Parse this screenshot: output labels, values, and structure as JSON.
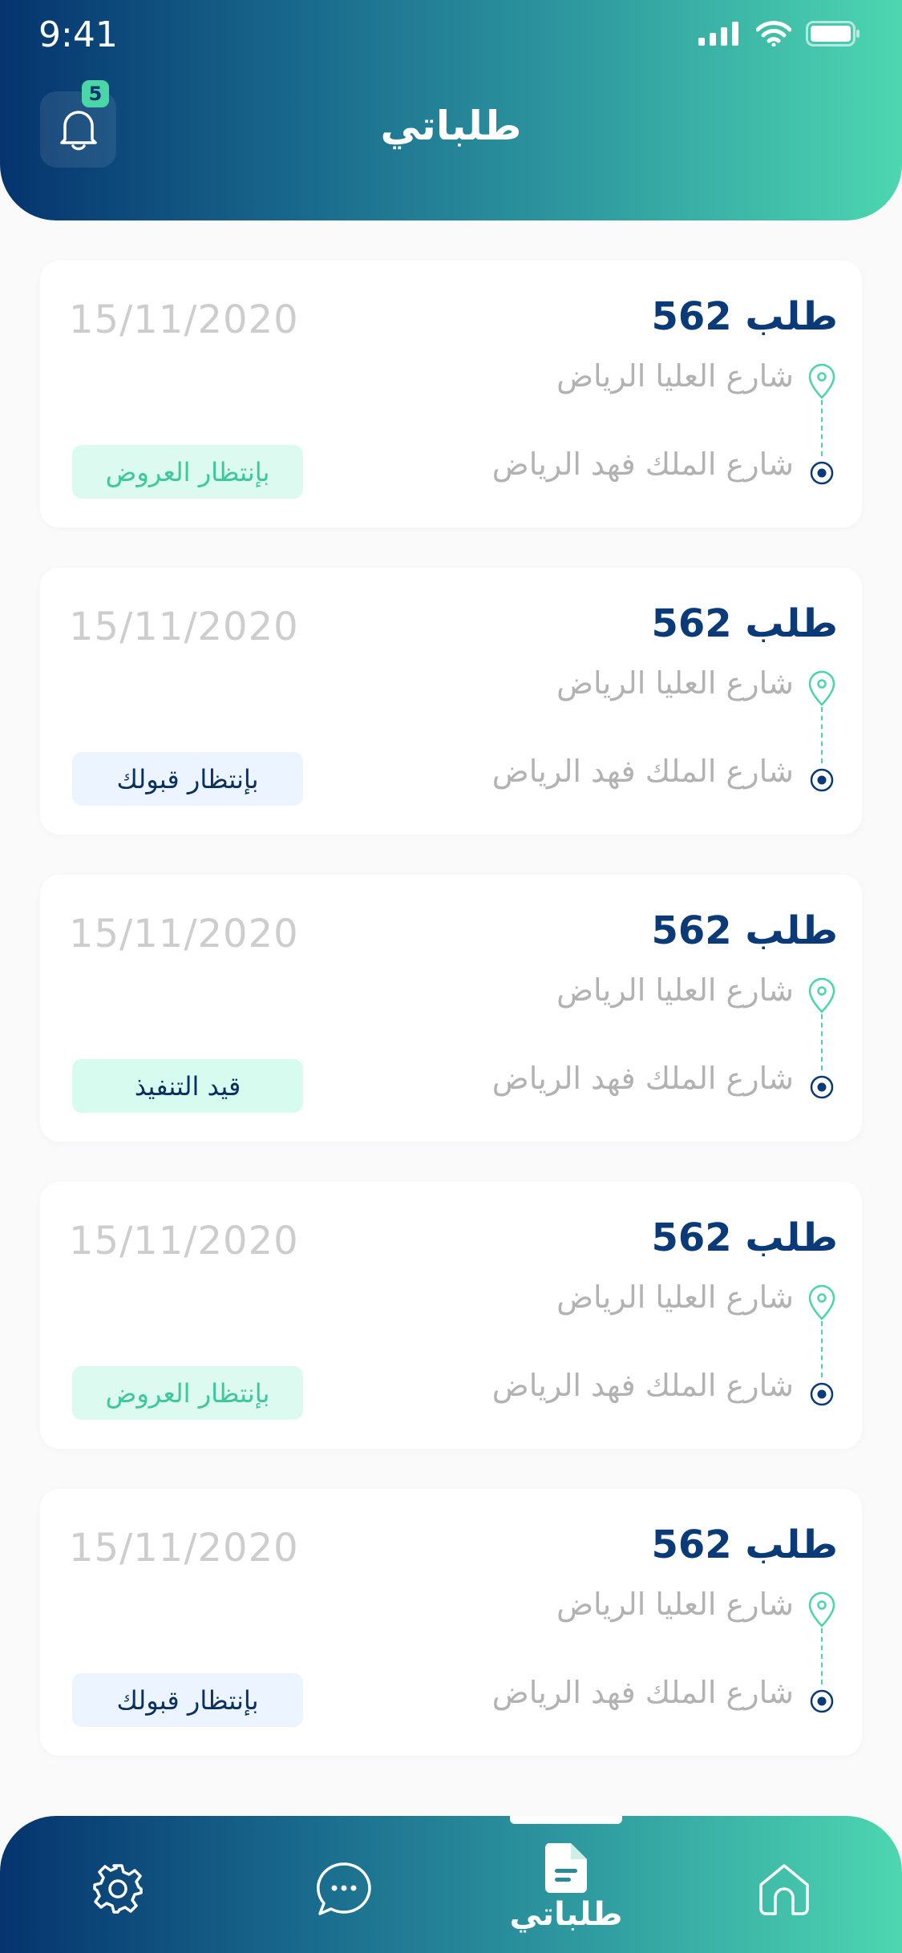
{
  "status_bar": {
    "time": "9:41"
  },
  "header": {
    "title": "طلباتي",
    "notification_count": "5"
  },
  "orders": [
    {
      "title": "طلب 562",
      "date": "15/11/2020",
      "from": "شارع العليا الرياض",
      "to": "شارع الملك فهد الرياض",
      "status": "بإنتظار العروض",
      "status_type": "offers"
    },
    {
      "title": "طلب 562",
      "date": "15/11/2020",
      "from": "شارع العليا الرياض",
      "to": "شارع الملك فهد الرياض",
      "status": "بإنتظار قبولك",
      "status_type": "accept"
    },
    {
      "title": "طلب 562",
      "date": "15/11/2020",
      "from": "شارع العليا الرياض",
      "to": "شارع الملك فهد الرياض",
      "status": "قيد التنفيذ",
      "status_type": "progress"
    },
    {
      "title": "طلب 562",
      "date": "15/11/2020",
      "from": "شارع العليا الرياض",
      "to": "شارع الملك فهد الرياض",
      "status": "بإنتظار العروض",
      "status_type": "offers"
    },
    {
      "title": "طلب 562",
      "date": "15/11/2020",
      "from": "شارع العليا الرياض",
      "to": "شارع الملك فهد الرياض",
      "status": "بإنتظار قبولك",
      "status_type": "accept"
    }
  ],
  "bottom_nav": {
    "active_label": "طلباتي",
    "items": [
      {
        "icon": "gear-icon"
      },
      {
        "icon": "chat-bubble-icon"
      },
      {
        "icon": "document-icon"
      },
      {
        "icon": "home-icon"
      }
    ]
  },
  "colors": {
    "brand_dark": "#05346e",
    "brand_accent": "#4dd6b0",
    "title_blue": "#0a3a78",
    "badge_offers_bg": "#dcfaef",
    "badge_accept_bg": "#ebf4ff"
  }
}
